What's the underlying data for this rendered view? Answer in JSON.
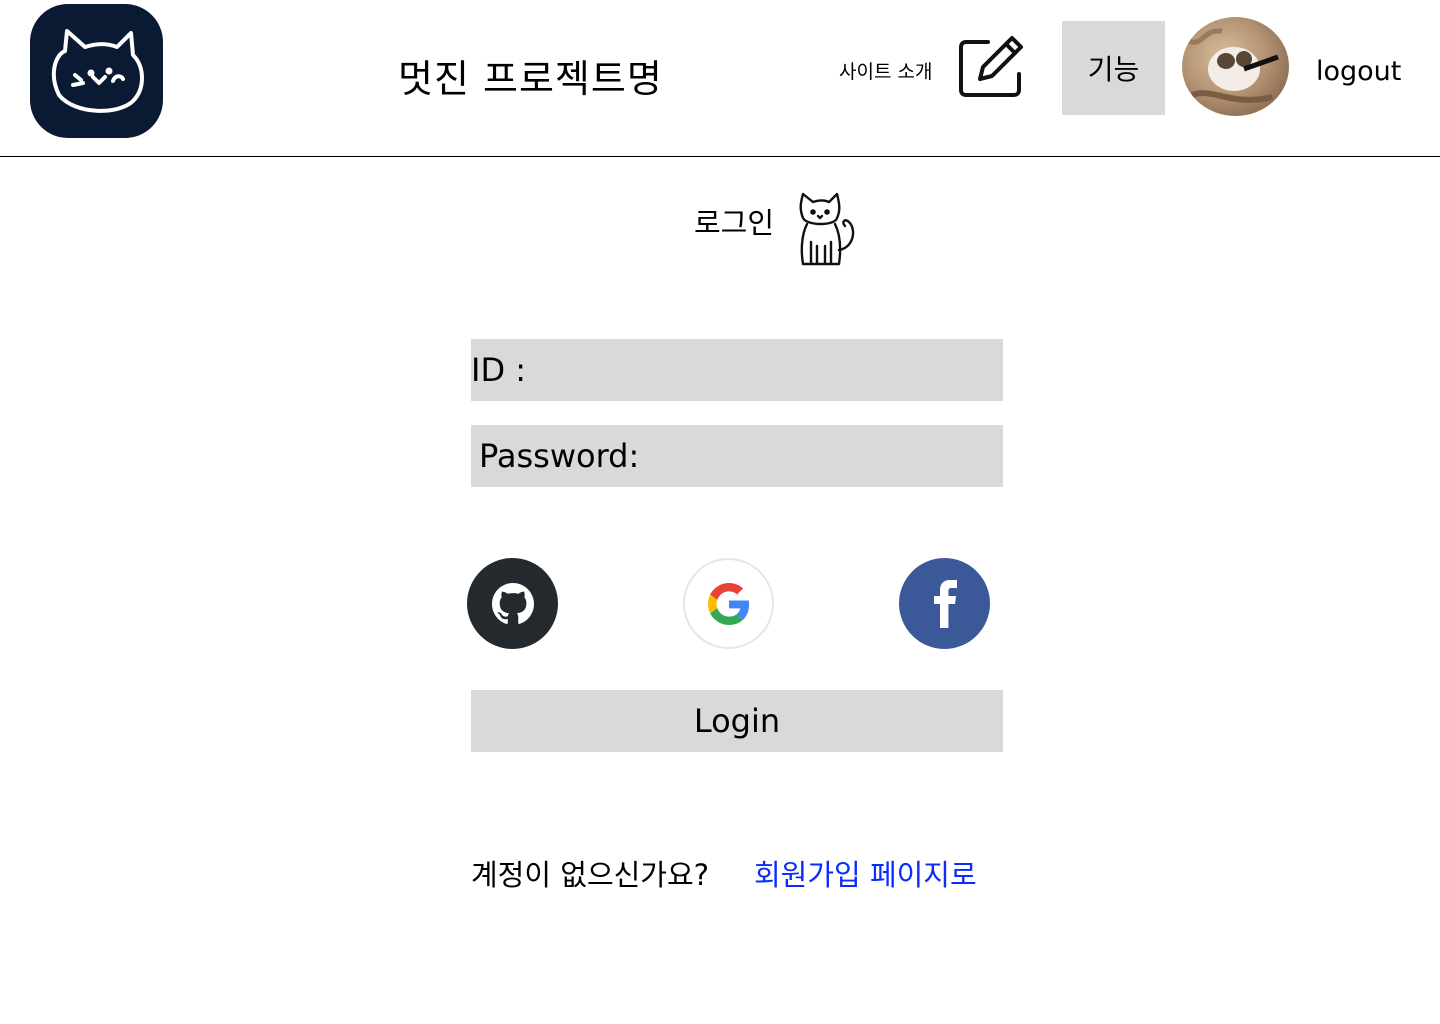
{
  "header": {
    "project_title": "멋진 프로젝트명",
    "about_label": "사이트 소개",
    "feature_label": "기능",
    "logout_label": "logout"
  },
  "icons": {
    "logo": "cat-logo-icon",
    "edit": "pencil-square-icon",
    "avatar": "user-avatar",
    "heading": "cat-icon",
    "github": "github-icon",
    "google": "google-icon",
    "facebook": "facebook-icon"
  },
  "login": {
    "heading": "로그인",
    "id_label": "ID :",
    "id_value": "",
    "password_label": "Password:",
    "password_value": "",
    "submit_label": "Login"
  },
  "signup": {
    "prompt": "계정이 없으신가요?",
    "link_label": "회원가입 페이지로"
  },
  "colors": {
    "logo_bg": "#0b1a33",
    "field_bg": "#d9d9d9",
    "link": "#0a2cff",
    "github": "#24292e",
    "facebook": "#3b5998"
  }
}
